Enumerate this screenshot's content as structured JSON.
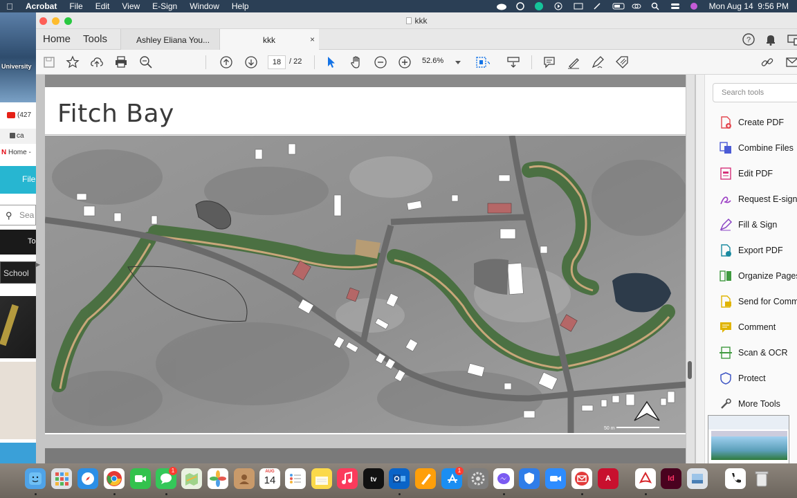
{
  "menubar": {
    "app_name": "Acrobat",
    "menus": [
      "File",
      "Edit",
      "View",
      "E-Sign",
      "Window",
      "Help"
    ],
    "clock": "Mon Aug 14  9:56 PM"
  },
  "background_window": {
    "banner_text": "University",
    "youtube_text": "(427",
    "address_text": "ca",
    "netflix_label": "N",
    "netflix_text": "Home -",
    "files_button": "File",
    "search_placeholder": "Sea",
    "dark_text": "To",
    "school_label": "School"
  },
  "window": {
    "title": "kkk"
  },
  "tabs": {
    "home": "Home",
    "tools": "Tools",
    "doc_tabs": [
      {
        "label": "Ashley Eliana You..."
      },
      {
        "label": "kkk",
        "close": "×"
      }
    ]
  },
  "toolbar": {
    "current_page": "18",
    "total_pages": "/ 22",
    "zoom": "52.6%"
  },
  "document": {
    "page_title": "Fitch Bay",
    "scale_bar_label": "50 m"
  },
  "tools_panel": {
    "search_placeholder": "Search tools",
    "items": [
      {
        "label": "Create PDF",
        "color": "#e34850"
      },
      {
        "label": "Combine Files",
        "color": "#4b5bd6"
      },
      {
        "label": "Edit PDF",
        "color": "#d6307a"
      },
      {
        "label": "Request E-signa",
        "color": "#9b3ec4"
      },
      {
        "label": "Fill & Sign",
        "color": "#8a44c4"
      },
      {
        "label": "Export PDF",
        "color": "#1a8aa0"
      },
      {
        "label": "Organize Pages",
        "color": "#3f9a3f"
      },
      {
        "label": "Send for Comme",
        "color": "#e0b400"
      },
      {
        "label": "Comment",
        "color": "#e0b400"
      },
      {
        "label": "Scan & OCR",
        "color": "#3f9a3f"
      },
      {
        "label": "Protect",
        "color": "#3f56c4"
      },
      {
        "label": "More Tools",
        "color": "#555555"
      }
    ]
  },
  "dock": {
    "calendar_month": "AUG",
    "calendar_day": "14",
    "messages_badge": "1",
    "appstore_badge": "1",
    "acrobat_label": "A",
    "indesign_label": "Id"
  }
}
